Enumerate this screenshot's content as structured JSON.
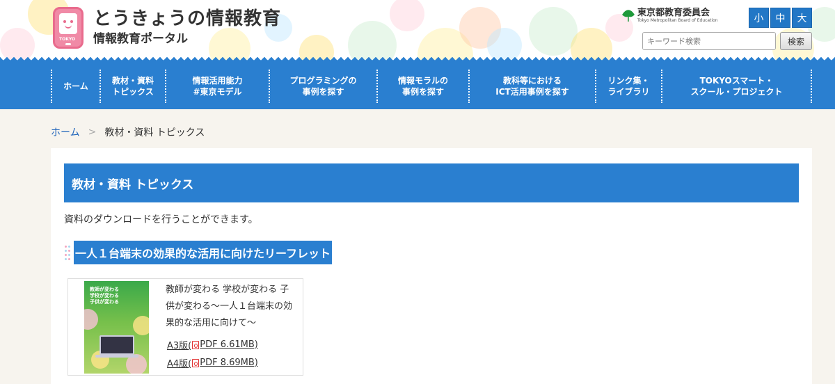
{
  "header": {
    "site_title": "とうきょうの情報教育",
    "site_subtitle": "情報教育ポータル",
    "mascot_tag": "TOKYO",
    "board_name": "東京都教育委員会",
    "board_name_en": "Tokyo Metropolitan Board of Education",
    "font_sizes": [
      "小",
      "中",
      "大"
    ],
    "search_placeholder": "キーワード検索",
    "search_button": "検索"
  },
  "nav": {
    "items": [
      {
        "label": "ホーム"
      },
      {
        "label": "教材・資料\nトピックス"
      },
      {
        "label": "情報活用能力\n#東京モデル"
      },
      {
        "label": "プログラミングの\n事例を探す"
      },
      {
        "label": "情報モラルの\n事例を探す"
      },
      {
        "label": "教科等における\nICT活用事例を探す"
      },
      {
        "label": "リンク集・\nライブラリ"
      },
      {
        "label": "TOKYOスマート・\nスクール・プロジェクト"
      }
    ]
  },
  "breadcrumb": {
    "home": "ホーム",
    "separator": ">",
    "current": "教材・資料 トピックス"
  },
  "content": {
    "page_heading": "教材・資料 トピックス",
    "intro": "資料のダウンロードを行うことができます。",
    "section_title": "一人１台端末の効果的な活用に向けたリーフレット",
    "item": {
      "thumb_text": "教師が変わる\n学校が変わる\n子供が変わる",
      "description": "教師が変わる 学校が変わる 子供が変わる～一人１台端末の効果的な活用に向けて～",
      "links": [
        {
          "prefix": "A3版(",
          "label": "PDF 6.61MB)"
        },
        {
          "prefix": "A4版(",
          "label": "PDF 8.69MB)"
        }
      ]
    }
  },
  "colors": {
    "brand_blue": "#2a7fd0",
    "pdf_red": "#e23232",
    "link_blue": "#2266bb"
  }
}
